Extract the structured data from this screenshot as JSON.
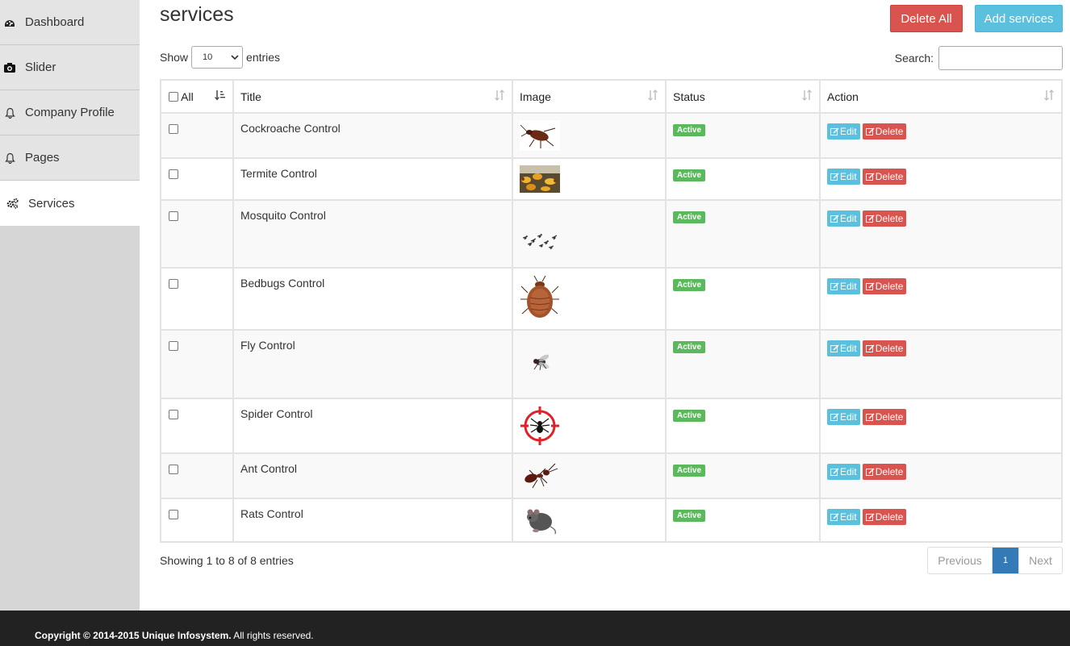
{
  "sidebar": {
    "items": [
      {
        "label": "Dashboard",
        "icon": "dashboard-icon"
      },
      {
        "label": "Slider",
        "icon": "camera-icon"
      },
      {
        "label": "Company Profile",
        "icon": "bell-icon"
      },
      {
        "label": "Pages",
        "icon": "bell-icon"
      },
      {
        "label": "Services",
        "icon": "gears-icon",
        "active": true
      }
    ]
  },
  "page": {
    "title": "services",
    "delete_all_label": "Delete All",
    "add_label": "Add services"
  },
  "table_controls": {
    "show_label": "Show",
    "entries_label": "entries",
    "page_length": "10",
    "search_label": "Search:",
    "search_value": ""
  },
  "table": {
    "headers": {
      "all": "All",
      "title": "Title",
      "image": "Image",
      "status": "Status",
      "action": "Action"
    },
    "rows": [
      {
        "title": "Cockroache Control",
        "image": "cockroach-image",
        "status": "Active"
      },
      {
        "title": "Termite Control",
        "image": "termite-image",
        "status": "Active"
      },
      {
        "title": "Mosquito Control",
        "image": "mosquito-image",
        "status": "Active"
      },
      {
        "title": "Bedbugs Control",
        "image": "bedbug-image",
        "status": "Active"
      },
      {
        "title": "Fly Control",
        "image": "fly-image",
        "status": "Active"
      },
      {
        "title": "Spider Control",
        "image": "spider-target-image",
        "status": "Active"
      },
      {
        "title": "Ant Control",
        "image": "ant-image",
        "status": "Active"
      },
      {
        "title": "Rats Control",
        "image": "rat-image",
        "status": "Active"
      }
    ],
    "edit_label": "Edit",
    "delete_label": "Delete"
  },
  "pagination": {
    "info": "Showing 1 to 8 of 8 entries",
    "previous": "Previous",
    "current": "1",
    "next": "Next"
  },
  "footer": {
    "copyright": "Copyright © 2014-2015 Unique Infosystem.",
    "rights": " All rights reserved."
  },
  "colors": {
    "danger": "#d9534f",
    "info": "#5bc0de",
    "success": "#5cb85c",
    "primary": "#337ab7",
    "sidebar": "#d6d6d6",
    "footer": "#222222"
  }
}
